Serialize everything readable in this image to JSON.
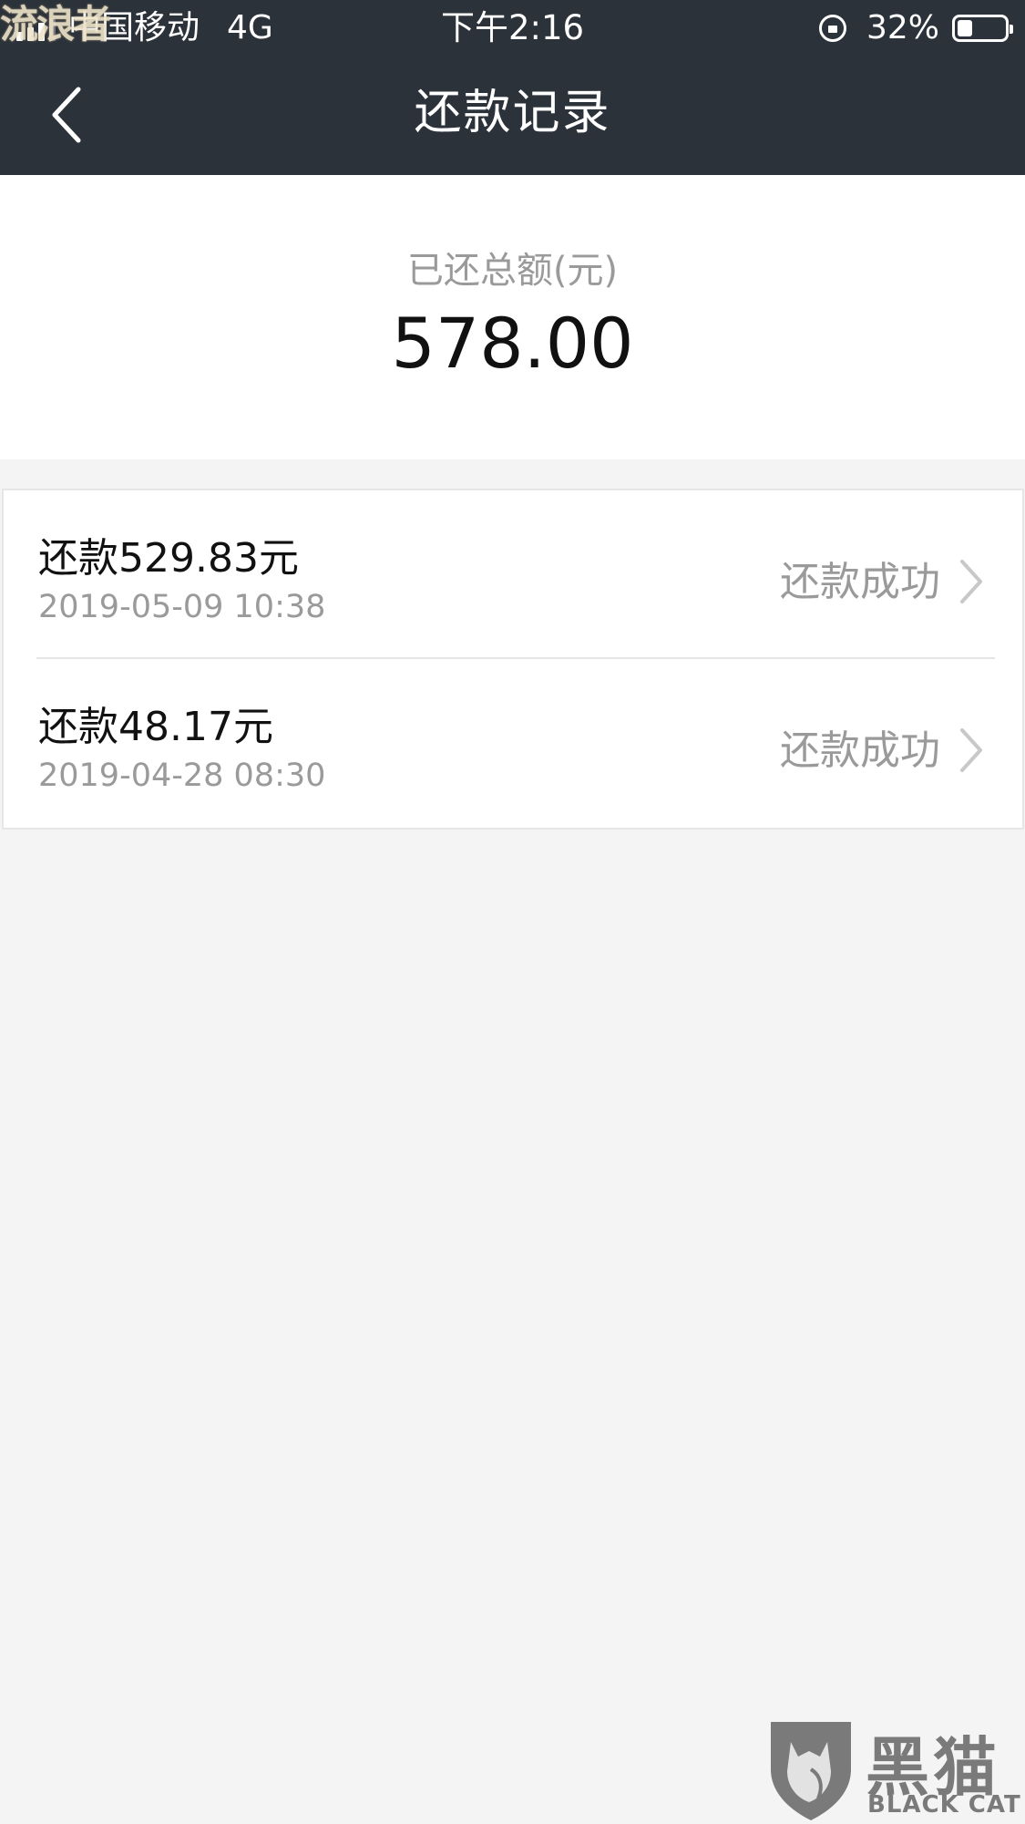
{
  "status_bar": {
    "carrier": "中国移动",
    "network": "4G",
    "time": "下午2:16",
    "battery": "32%",
    "battery_level": 0.32,
    "overlay_watermark": "流浪者"
  },
  "nav": {
    "title": "还款记录",
    "back_icon": "chevron-left-icon"
  },
  "summary": {
    "label": "已还总额(元)",
    "amount": "578.00"
  },
  "records": [
    {
      "title": "还款529.83元",
      "datetime": "2019-05-09 10:38",
      "status": "还款成功"
    },
    {
      "title": "还款48.17元",
      "datetime": "2019-04-28 08:30",
      "status": "还款成功"
    }
  ],
  "watermark": {
    "cn": "黑猫",
    "en": "BLACK CAT"
  },
  "colors": {
    "header_bg": "#2b323a",
    "page_bg": "#f4f4f4",
    "muted_text": "#9a9a9a"
  }
}
